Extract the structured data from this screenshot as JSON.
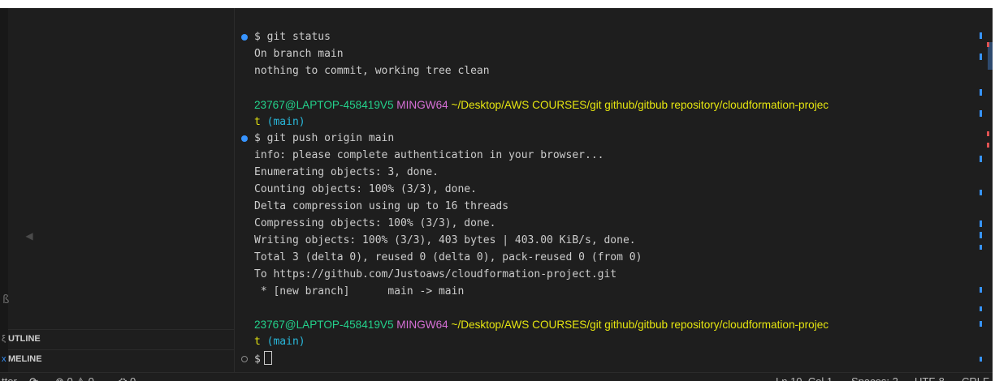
{
  "sidebar": {
    "collapse_glyph": "◀",
    "side_glyph": "ß",
    "outline_label": "UTLINE",
    "outline_glyph": "ξ",
    "timeline_label": "MELINE",
    "timeline_glyph": "x"
  },
  "terminal": {
    "lines": [
      {
        "kind": "cmd",
        "deco": "ok",
        "text": "$ git status"
      },
      {
        "kind": "out",
        "text": "On branch main"
      },
      {
        "kind": "out",
        "text": "nothing to commit, working tree clean"
      },
      {
        "kind": "blank"
      },
      {
        "kind": "prompt",
        "user": "23767@LAPTOP-458419V5",
        "sys": "MINGW64",
        "path": "~/Desktop/AWS COURSES/git github/gitbub repository/cloudformation-projec"
      },
      {
        "kind": "wrap",
        "path_tail": "t",
        "branch": "(main)"
      },
      {
        "kind": "cmd",
        "deco": "ok",
        "text": "$ git push origin main"
      },
      {
        "kind": "out",
        "text": "info: please complete authentication in your browser..."
      },
      {
        "kind": "out",
        "text": "Enumerating objects: 3, done."
      },
      {
        "kind": "out",
        "text": "Counting objects: 100% (3/3), done."
      },
      {
        "kind": "out",
        "text": "Delta compression using up to 16 threads"
      },
      {
        "kind": "out",
        "text": "Compressing objects: 100% (3/3), done."
      },
      {
        "kind": "out",
        "text": "Writing objects: 100% (3/3), 403 bytes | 403.00 KiB/s, done."
      },
      {
        "kind": "out",
        "text": "Total 3 (delta 0), reused 0 (delta 0), pack-reused 0 (from 0)"
      },
      {
        "kind": "out",
        "text": "To https://github.com/Justoaws/cloudformation-project.git"
      },
      {
        "kind": "out",
        "text": " * [new branch]      main -> main"
      },
      {
        "kind": "blank"
      },
      {
        "kind": "prompt",
        "user": "23767@LAPTOP-458419V5",
        "sys": "MINGW64",
        "path": "~/Desktop/AWS COURSES/git github/gitbub repository/cloudformation-projec"
      },
      {
        "kind": "wrap",
        "path_tail": "t",
        "branch": "(main)"
      },
      {
        "kind": "input",
        "deco": "pending",
        "text": "$"
      }
    ]
  },
  "statusbar": {
    "left_text": "tter",
    "sync_icon": "⟳",
    "errors_icon": "⊗",
    "errors": "0",
    "warnings_icon": "⚠",
    "warnings": "0",
    "ports_icon": "⛭",
    "ports": "0",
    "position": "Ln 10, Col 1",
    "spaces": "Spaces: 2",
    "encoding": "UTF-8",
    "eol": "CRLF"
  },
  "colors": {
    "background": "#1e1e1e",
    "text": "#cccccc",
    "prompt_user": "#23d18b",
    "prompt_system": "#d670d6",
    "prompt_path": "#e5e510",
    "prompt_branch": "#29b8db",
    "success_decoration": "#3794ff"
  }
}
